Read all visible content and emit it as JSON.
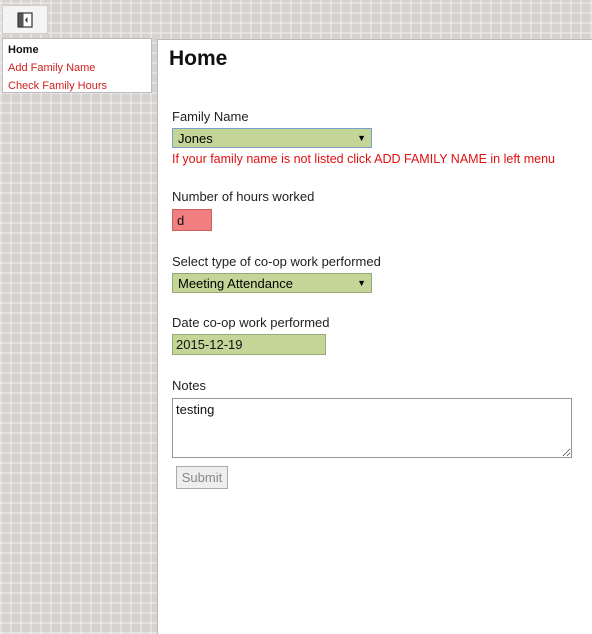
{
  "sidebar_toggle": {
    "icon": "sidebar-toggle-icon"
  },
  "sidebar": {
    "items": [
      {
        "label": "Home",
        "active": true
      },
      {
        "label": "Add Family Name",
        "active": false
      },
      {
        "label": "Check Family Hours",
        "active": false
      }
    ]
  },
  "main": {
    "title": "Home",
    "family_name": {
      "label": "Family Name",
      "value": "Jones",
      "hint": "If your family name is not listed click ADD FAMILY NAME in left menu"
    },
    "hours": {
      "label": "Number of hours worked",
      "value": "d"
    },
    "work_type": {
      "label": "Select type of co-op work performed",
      "value": "Meeting Attendance"
    },
    "date": {
      "label": "Date co-op work performed",
      "value": "2015-12-19"
    },
    "notes": {
      "label": "Notes",
      "value": "testing"
    },
    "submit_label": "Submit"
  },
  "colors": {
    "field_green": "#c3d597",
    "error_red": "#f27f7f",
    "link_red": "#d02020",
    "hint_red": "#dd1111"
  }
}
